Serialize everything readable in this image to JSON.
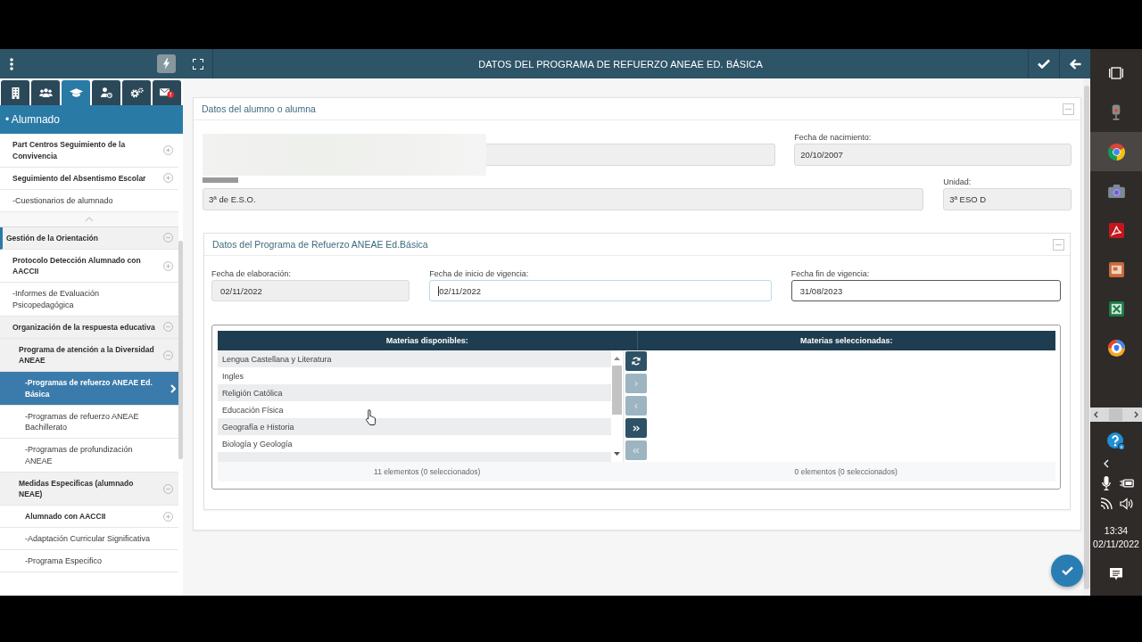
{
  "sidebar": {
    "tabs": [
      {
        "kind": "building",
        "selected": false
      },
      {
        "kind": "people",
        "selected": false
      },
      {
        "kind": "cap",
        "selected": true
      },
      {
        "kind": "badge",
        "selected": false
      },
      {
        "kind": "gears",
        "selected": false
      },
      {
        "kind": "mail",
        "selected": false
      }
    ],
    "section_title": "• Alumnado",
    "items": [
      {
        "label": "Part Centros Seguimiento de la Convivencia",
        "expanded": false,
        "selected": false
      },
      {
        "label": "Seguimiento del Absentismo Escolar",
        "expanded": false,
        "selected": false
      },
      {
        "label": "-Cuestionarios de alumnado",
        "selected": false
      }
    ],
    "tree": [
      {
        "label": "Gestión de la Orientación",
        "expanded": true,
        "selected": false,
        "children": [
          {
            "label": "Protocolo Detección Alumnado con AACCII",
            "expanded": false,
            "selected": false
          },
          {
            "label": "-Informes de Evaluación Psicopedagógica",
            "selected": false
          },
          {
            "label": "Organización de la respuesta educativa",
            "expanded": true,
            "selected": false,
            "children": [
              {
                "label": "Programa de atención a la Diversidad ANEAE",
                "expanded": true,
                "selected": false,
                "children": [
                  {
                    "label": "-Programas de refuerzo ANEAE Ed. Básica",
                    "selected": true
                  },
                  {
                    "label": "-Programas de refuerzo ANEAE Bachillerato",
                    "selected": false
                  },
                  {
                    "label": "-Programas de profundización ANEAE",
                    "selected": false
                  }
                ]
              },
              {
                "label": "Medidas Especificas (alumnado NEAE)",
                "expanded": true,
                "selected": false,
                "children": [
                  {
                    "label": "Alumnado con AACCII",
                    "expanded": false,
                    "selected": false
                  },
                  {
                    "label": "-Adaptación Curricular Significativa",
                    "selected": false
                  },
                  {
                    "label": "-Programa Especifico",
                    "selected": false
                  }
                ]
              }
            ]
          }
        ]
      }
    ]
  },
  "header": {
    "title": "DATOS DEL PROGRAMA DE REFUERZO ANEAE ED. BÁSICA"
  },
  "student_panel": {
    "title": "Datos del alumno o alumna",
    "rows": [
      [
        {
          "kind": "blurred"
        },
        {
          "kind": "text",
          "label": "Fecha de nacimiento:",
          "value": "20/10/2007"
        }
      ],
      [
        {
          "kind": "covered_label",
          "value": "3ª de E.S.O."
        },
        {
          "kind": "text",
          "label": "Unidad:",
          "value": "3ª ESO D"
        }
      ]
    ]
  },
  "program_panel": {
    "title": "Datos del Programa de Refuerzo ANEAE Ed.Básica",
    "fields": [
      {
        "label": "Fecha de elaboración:",
        "value": "02/11/2022",
        "disabled": true,
        "focused": false
      },
      {
        "label": "Fecha de inicio de vigencia:",
        "value": "02/11/2022",
        "disabled": false,
        "focused": true
      },
      {
        "label": "Fecha fin de vigencia:",
        "value": "31/08/2023",
        "disabled": false,
        "focused": false
      }
    ]
  },
  "subjects": {
    "available_title": "Materias disponibles:",
    "selected_title": "Materias seleccionadas:",
    "available": [
      {
        "label": "Lengua Castellana y Literatura",
        "selected": false
      },
      {
        "label": "Ingles",
        "selected": false
      },
      {
        "label": "Religión Católica",
        "selected": false
      },
      {
        "label": "Educación Física",
        "selected": false
      },
      {
        "label": "Geografía e Historia",
        "selected": false
      },
      {
        "label": "Biología y Geología",
        "selected": false
      }
    ],
    "buttons": [
      {
        "kind": "refresh",
        "disabled": false
      },
      {
        "kind": "move",
        "disabled": true
      },
      {
        "kind": "remove",
        "disabled": true
      },
      {
        "kind": "move_all",
        "disabled": false
      },
      {
        "kind": "remove_all",
        "disabled": true
      }
    ],
    "available_count": "11 elementos (0 seleccionados)",
    "selected_count": "0 elementos (0 seleccionados)"
  },
  "taskbar": {
    "apps": [
      {
        "kind": "recorder",
        "active": false
      },
      {
        "kind": "browser",
        "active": true
      },
      {
        "kind": "camera",
        "active": false
      },
      {
        "kind": "pdf",
        "active": false
      },
      {
        "kind": "slides",
        "active": false
      },
      {
        "kind": "sheet",
        "active": false
      },
      {
        "kind": "vpn",
        "active": false
      }
    ],
    "time": "13:34",
    "date": "02/11/2022"
  }
}
